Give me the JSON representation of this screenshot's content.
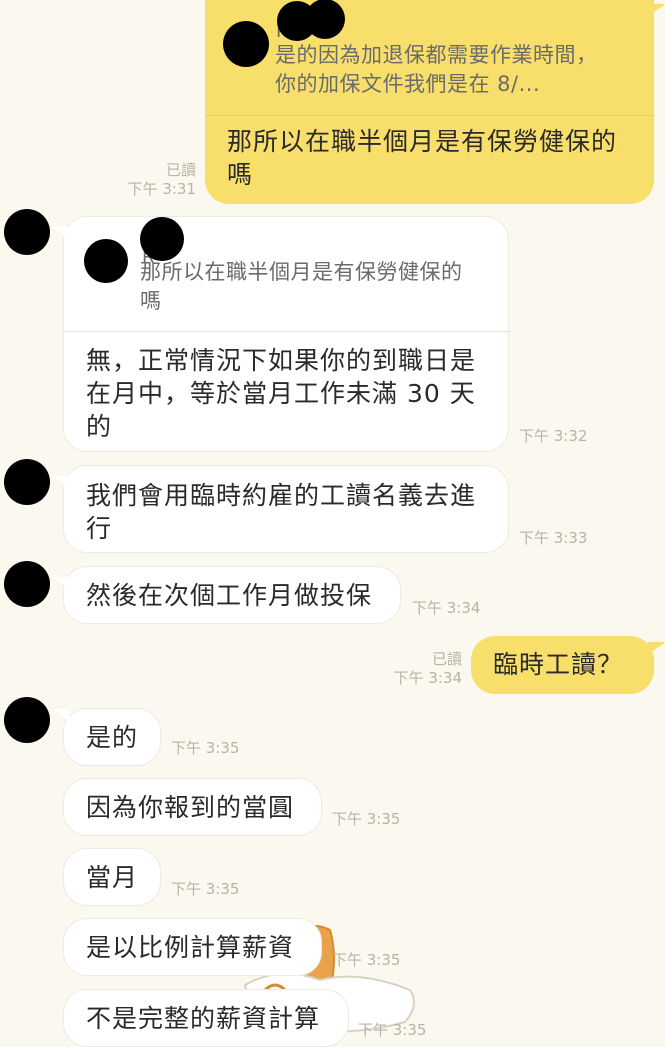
{
  "colors": {
    "background": "#fbf8ef",
    "outgoing": "#f8df6b",
    "incoming": "#ffffff",
    "meta": "#b8b3a4"
  },
  "messages": [
    {
      "id": "m1",
      "direction": "out",
      "quote_sender": "R",
      "quote_text": "是的因為加退保都需要作業時間，你的加保文件我們是在 8/...",
      "text": "那所以在職半個月是有保勞健保的嗎",
      "read": "已讀",
      "time": "下午 3:31"
    },
    {
      "id": "m2",
      "direction": "in",
      "quote_sender": "R",
      "quote_text": "那所以在職半個月是有保勞健保的嗎",
      "text": "無，正常情況下如果你的到職日是在月中，等於當月工作未滿 30 天的",
      "time": "下午 3:32"
    },
    {
      "id": "m3",
      "direction": "in",
      "text": "我們會用臨時約雇的工讀名義去進行",
      "time": "下午 3:33"
    },
    {
      "id": "m4",
      "direction": "in",
      "text": "然後在次個工作月做投保",
      "time": "下午 3:34"
    },
    {
      "id": "m5",
      "direction": "out",
      "text": "臨時工讀？",
      "read": "已讀",
      "time": "下午 3:34"
    },
    {
      "id": "m6",
      "direction": "in",
      "text": "是的",
      "time": "下午 3:35"
    },
    {
      "id": "m7",
      "direction": "in",
      "text": "因為你報到的當圓",
      "time": "下午 3:35"
    },
    {
      "id": "m8",
      "direction": "in",
      "text": "當月",
      "time": "下午 3:35"
    },
    {
      "id": "m9",
      "direction": "in",
      "text": "是以比例計算薪資",
      "time": "下午 3:35"
    },
    {
      "id": "m10",
      "direction": "in",
      "text": "不是完整的薪資計算",
      "time": "下午 3:35"
    }
  ]
}
